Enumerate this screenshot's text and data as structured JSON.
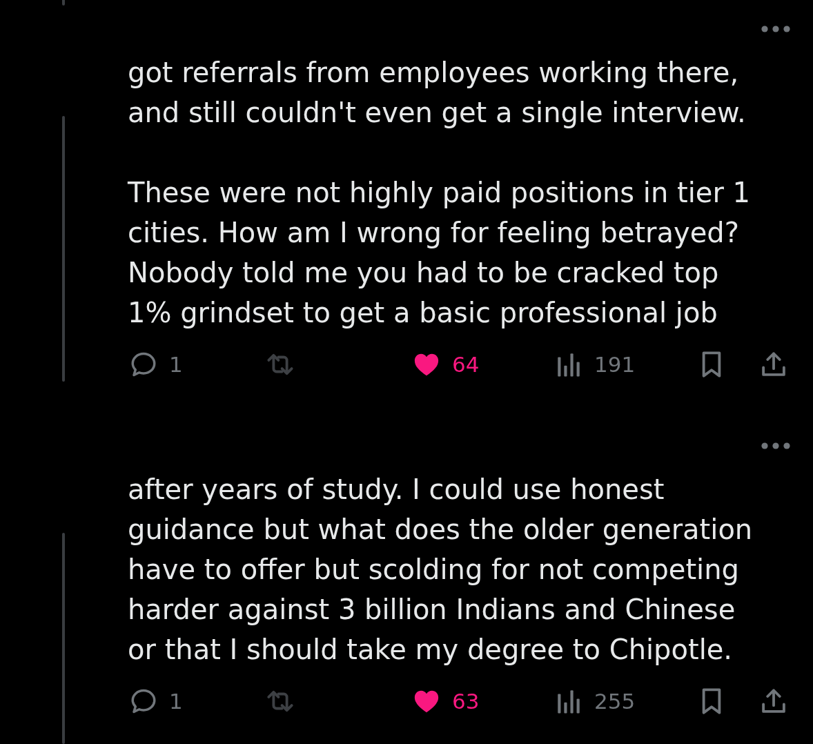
{
  "posts": [
    {
      "paragraphs": [
        "got referrals from employees working there,\nand still couldn't even get a single interview.",
        "These were not highly paid positions in tier 1\ncities. How am I wrong for feeling betrayed?\nNobody told me you had to be cracked top\n1% grindset to get a basic professional job"
      ],
      "actions": {
        "reply": {
          "count": "1"
        },
        "repost": {
          "disabled": true
        },
        "like": {
          "count": "64",
          "liked": true
        },
        "views": {
          "count": "191"
        }
      }
    },
    {
      "paragraphs": [
        "after years of study. I could use honest\nguidance but what does the older generation\nhave to offer but scolding for not competing\nharder against 3 billion Indians and Chinese\nor that I should take my degree to Chipotle."
      ],
      "actions": {
        "reply": {
          "count": "1"
        },
        "repost": {
          "disabled": true
        },
        "like": {
          "count": "63",
          "liked": true
        },
        "views": {
          "count": "255"
        }
      }
    }
  ]
}
